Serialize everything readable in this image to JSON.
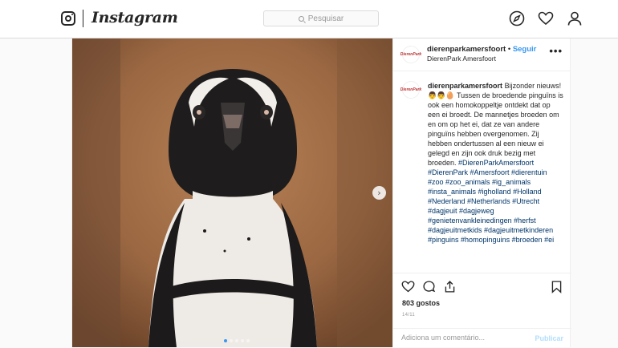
{
  "header": {
    "logo_text": "Instagram",
    "search_placeholder": "Pesquisar"
  },
  "post": {
    "username": "dierenparkamersfoort",
    "separator": "•",
    "follow_label": "Seguir",
    "location": "DierenPark Amersfoort",
    "more_label": "•••",
    "avatar_text": "DierenPark Amersfoort",
    "caption_text": "Bijzonder nieuws! 👨‍👨‍🥚 Tussen de broedende pinguïns is ook een homokoppeltje ontdekt dat op een ei broedt. De mannetjes broeden om en om op het ei, dat ze van andere pinguïns hebben overgenomen. Zij hebben ondertussen al een nieuw ei gelegd en zijn ook druk bezig met broeden.",
    "hashtags": "#DierenParkAmersfoort #DierenPark #Amersfoort #dierentuin #zoo #zoo_animals #ig_animals #insta_animals #igholland #Holland #Nederland #Netherlands #Utrecht #dagjeuit #dagjeweg #genietenvankleinedingen #herfst #dagjeuitmetkids #dagjeuitmetkinderen #pinguins #homopinguins #broeden #ei",
    "likes": "803 gostos",
    "date": "14/11",
    "comment_placeholder": "Adiciona um comentário...",
    "publish_label": "Publicar",
    "carousel_next": "›",
    "carousel_count": 5,
    "carousel_active": 1
  },
  "colors": {
    "link_blue": "#3897f0",
    "hashtag": "#003569",
    "border": "#dbdbdb"
  },
  "icons": [
    "instagram-glyph-icon",
    "search-icon",
    "explore-compass-icon",
    "activity-heart-icon",
    "profile-icon",
    "like-heart-icon",
    "comment-icon",
    "share-icon",
    "save-bookmark-icon",
    "chevron-right-icon"
  ]
}
